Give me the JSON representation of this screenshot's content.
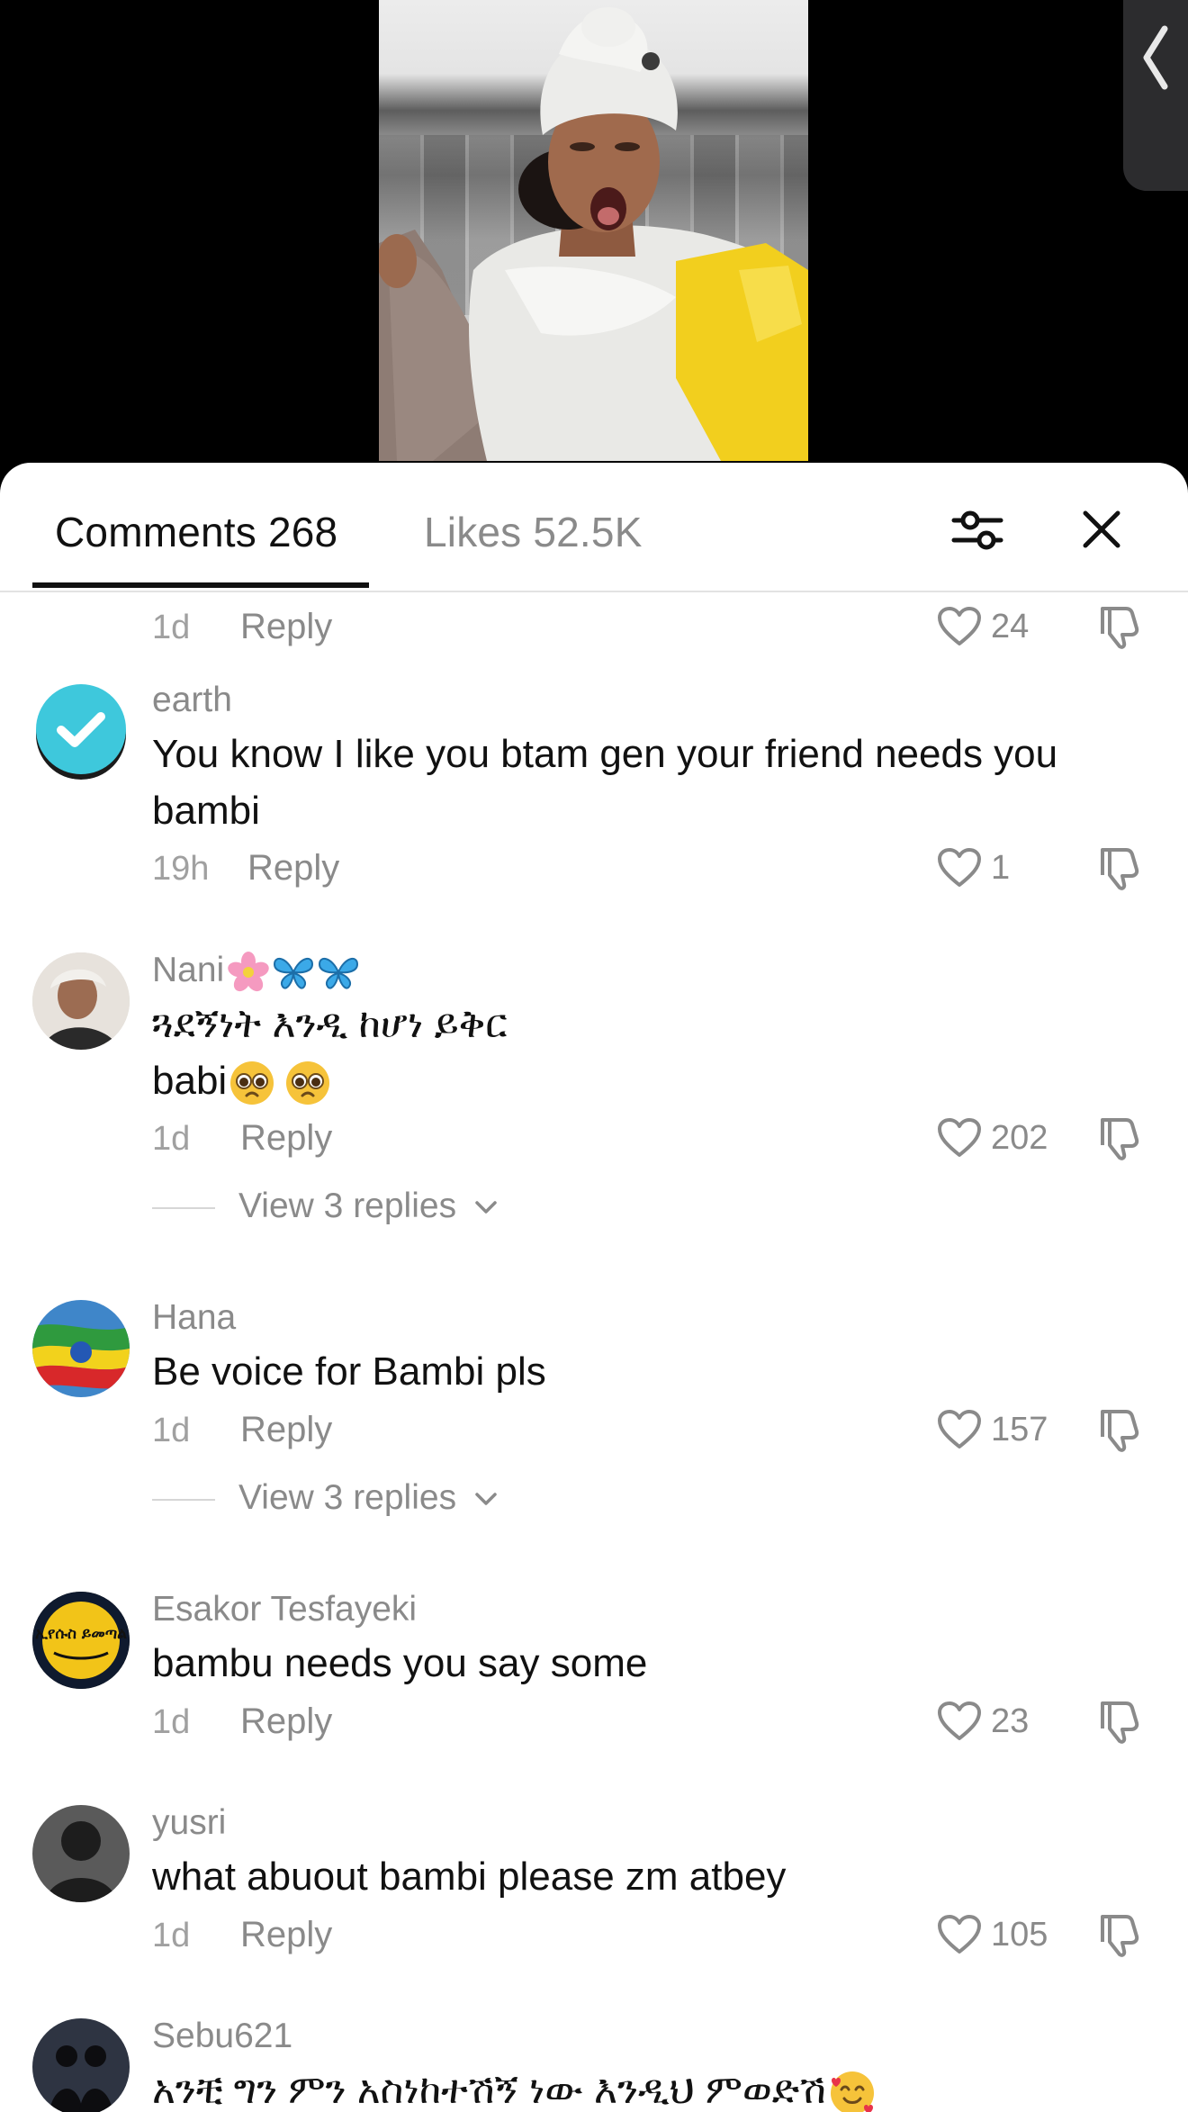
{
  "tabs": {
    "comments_label": "Comments 268",
    "likes_label": "Likes 52.5K"
  },
  "top_partial": {
    "time": "1d",
    "reply_label": "Reply",
    "likes": "24"
  },
  "comments": [
    {
      "username": "earth",
      "text": "You know I like you btam gen your friend needs you bambi",
      "time": "19h",
      "reply_label": "Reply",
      "likes": "1"
    },
    {
      "username": "Nani",
      "line1": "ጓደኝነት እንዲ ከሆነ ይቅር",
      "line2": "babi",
      "time": "1d",
      "reply_label": "Reply",
      "likes": "202",
      "view_replies": "View 3 replies"
    },
    {
      "username": "Hana",
      "text": "Be voice for Bambi pls",
      "time": "1d",
      "reply_label": "Reply",
      "likes": "157",
      "view_replies": "View 3 replies"
    },
    {
      "username": "Esakor Tesfayeki",
      "text": "bambu needs you say some",
      "time": "1d",
      "reply_label": "Reply",
      "likes": "23",
      "avatar_text": "ኢየሱስ ይመጣል"
    },
    {
      "username": "yusri",
      "text": "what abuout bambi please zm atbey",
      "time": "1d",
      "reply_label": "Reply",
      "likes": "105"
    },
    {
      "username": "Sebu621",
      "text": "አንቺ ግን ምን አስነከተሽኝ ነው እንዲህ ምወድሽ"
    }
  ],
  "icons": {
    "filter": "sliders-icon",
    "close": "close-icon",
    "like": "heart-outline-icon",
    "dislike": "thumbs-down-icon",
    "back": "chevron-left-icon"
  },
  "colors": {
    "text_primary": "#111111",
    "text_secondary": "#8a8a8a",
    "sheet_bg": "#ffffff",
    "verified_badge": "#3ec8dc"
  }
}
